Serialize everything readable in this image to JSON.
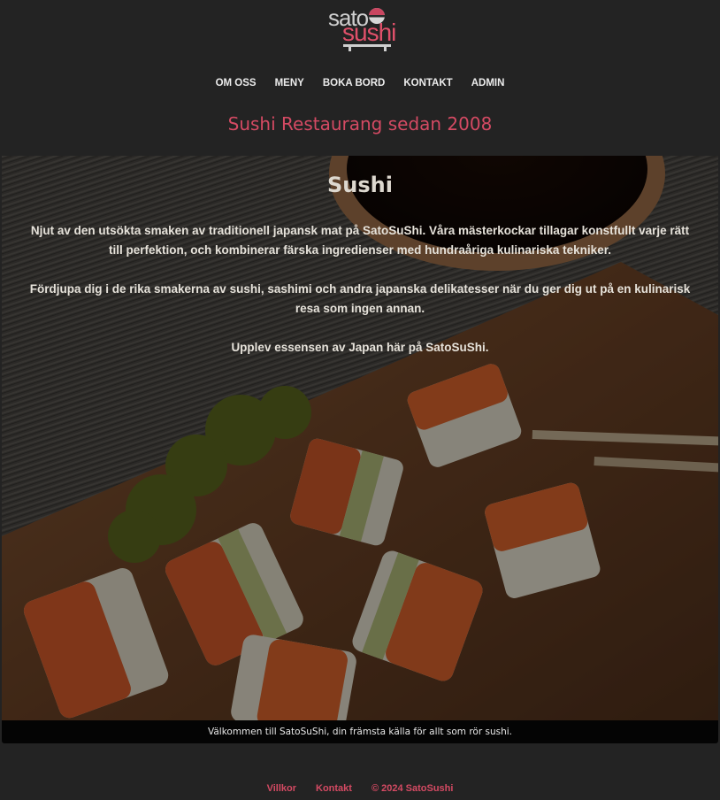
{
  "brand": {
    "logo_top": "sato",
    "logo_bottom": "sushi",
    "accent_color": "#d44a63"
  },
  "nav": {
    "items": [
      {
        "label": "OM OSS"
      },
      {
        "label": "MENY"
      },
      {
        "label": "BOKA BORD"
      },
      {
        "label": "KONTAKT"
      },
      {
        "label": "ADMIN"
      }
    ]
  },
  "tagline": "Sushi Restaurang sedan 2008",
  "hero": {
    "title": "Sushi",
    "paragraphs": [
      "Njut av den utsökta smaken av traditionell japansk mat på SatoSuShi. Våra mästerkockar tillagar konstfullt varje rätt till perfektion, och kombinerar färska ingredienser med hundraåriga kulinariska tekniker.",
      "Fördjupa dig i de rika smakerna av sushi, sashimi och andra japanska delikatesser när du ger dig ut på en kulinarisk resa som ingen annan.",
      "Upplev essensen av Japan här på SatoSuShi."
    ],
    "image_icon": "sushi-photo-background"
  },
  "welcome_text": "Välkommen till SatoSuShi, din främsta källa för allt som rör sushi.",
  "footer": {
    "terms": "Villkor",
    "contact": "Kontakt",
    "copyright": "© 2024 SatoSushi"
  }
}
